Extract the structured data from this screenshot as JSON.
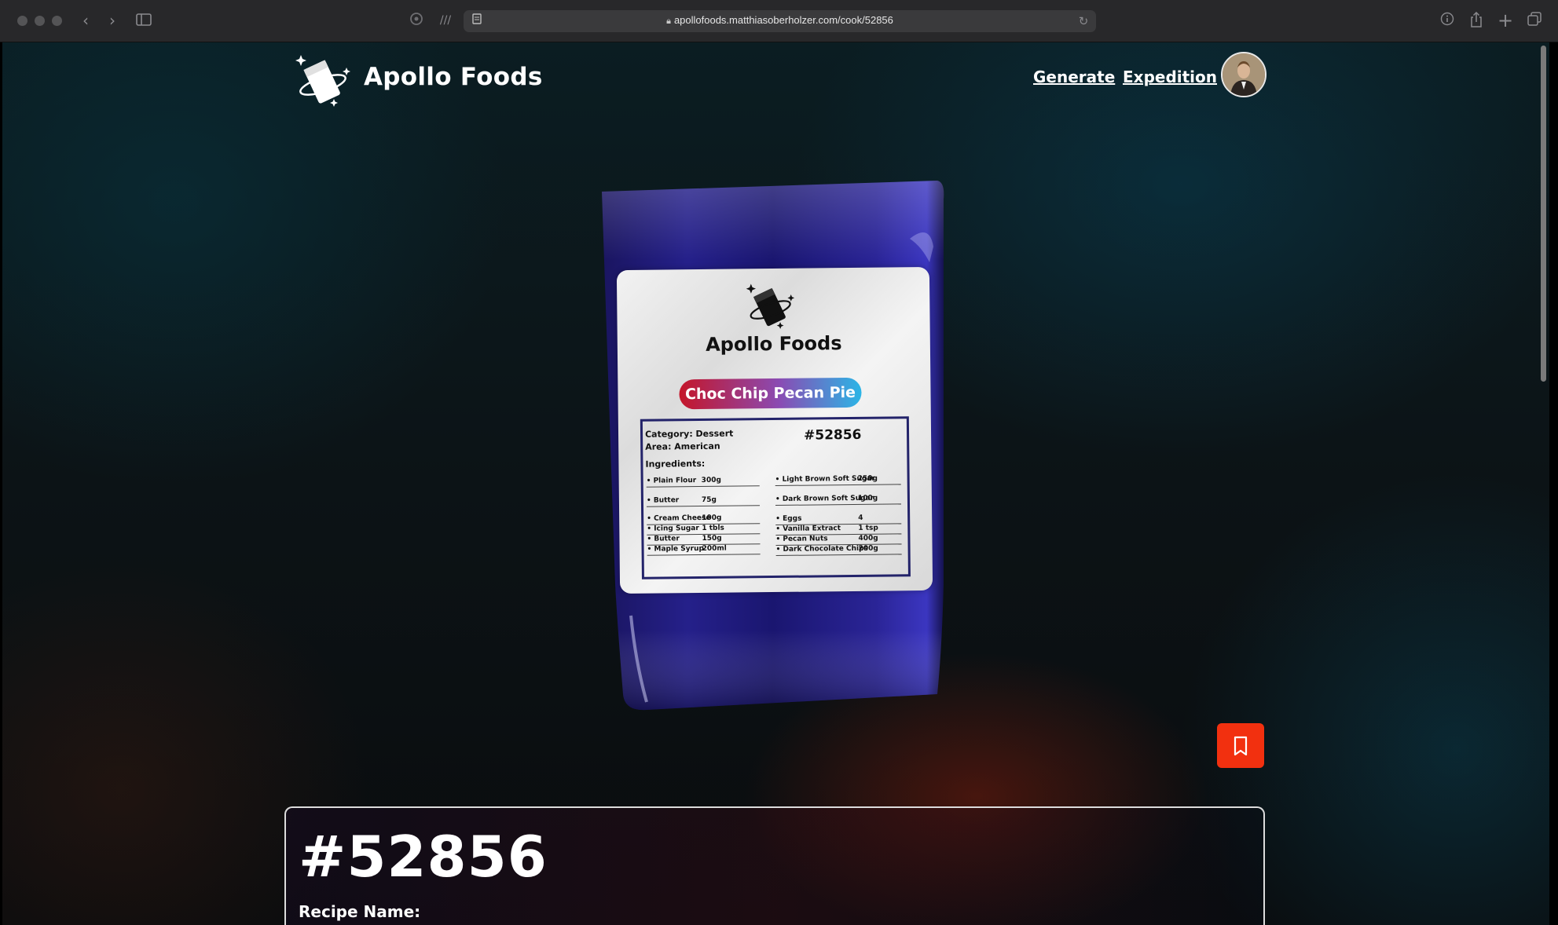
{
  "browser": {
    "url": "apollofoods.matthiasoberholzer.com/cook/52856"
  },
  "header": {
    "brand": "Apollo Foods",
    "nav": [
      "Generate",
      "Expedition"
    ]
  },
  "package": {
    "brand": "Apollo Foods",
    "recipe_title": "Choc Chip Pecan Pie",
    "category": "Category: Dessert",
    "area": "Area: American",
    "id": "#52856",
    "ingredients_heading": "Ingredients:",
    "ingredients_left": [
      {
        "name": "• Plain Flour",
        "qty": "300g"
      },
      {
        "name": "• Butter",
        "qty": "75g"
      },
      {
        "name": "• Cream Cheese",
        "qty": "100g"
      },
      {
        "name": "• Icing Sugar",
        "qty": "1 tbls"
      },
      {
        "name": "• Butter",
        "qty": "150g"
      },
      {
        "name": "• Maple Syrup",
        "qty": "200ml"
      }
    ],
    "ingredients_right": [
      {
        "name": "• Light Brown Soft Sugar",
        "qty": "250g"
      },
      {
        "name": "• Dark Brown Soft Sugar",
        "qty": "100g"
      },
      {
        "name": "• Eggs",
        "qty": "4"
      },
      {
        "name": "• Vanilla Extract",
        "qty": "1 tsp"
      },
      {
        "name": "• Pecan Nuts",
        "qty": "400g"
      },
      {
        "name": "• Dark Chocolate Chips",
        "qty": "200g"
      }
    ]
  },
  "card": {
    "title": "#52856",
    "recipe_name_label": "Recipe Name:"
  },
  "colors": {
    "bookmark_button": "#f2300f",
    "bag": "#1c1670"
  },
  "icons": [
    "back-icon",
    "forward-icon",
    "sidebar-icon",
    "reader-icon",
    "reload-icon",
    "info-icon",
    "share-icon",
    "new-tab-icon",
    "tabs-overview-icon",
    "bookmark-icon"
  ]
}
